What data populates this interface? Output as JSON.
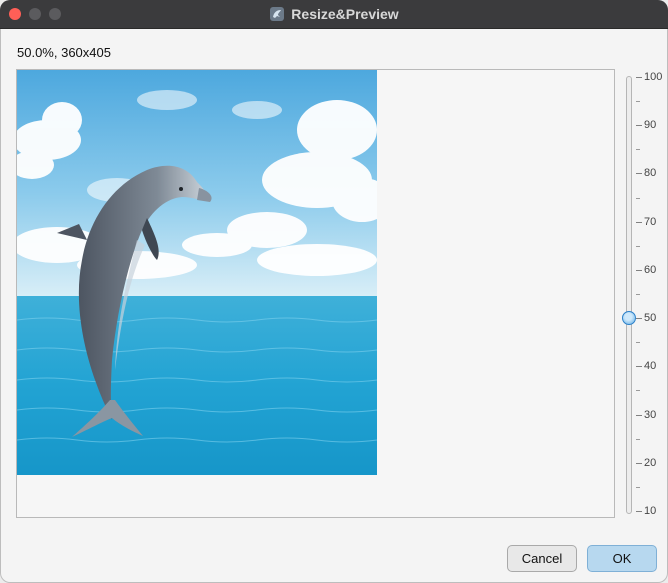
{
  "window": {
    "title": "Resize&Preview",
    "app_icon": "dolphin-app-icon"
  },
  "status": {
    "text": "50.0%, 360x405"
  },
  "preview": {
    "image": "dolphin-leaping-over-ocean",
    "zoom_percent": 50.0,
    "width": 360,
    "height": 405
  },
  "slider": {
    "min": 10,
    "max": 100,
    "value": 50,
    "labels": [
      "100",
      "90",
      "80",
      "70",
      "60",
      "50",
      "40",
      "30",
      "20",
      "10"
    ]
  },
  "buttons": {
    "cancel_label": "Cancel",
    "ok_label": "OK"
  },
  "colors": {
    "titlebar": "#3b3b3d",
    "ok_button": "#b7d8ef",
    "accent": "#2c80c9"
  }
}
